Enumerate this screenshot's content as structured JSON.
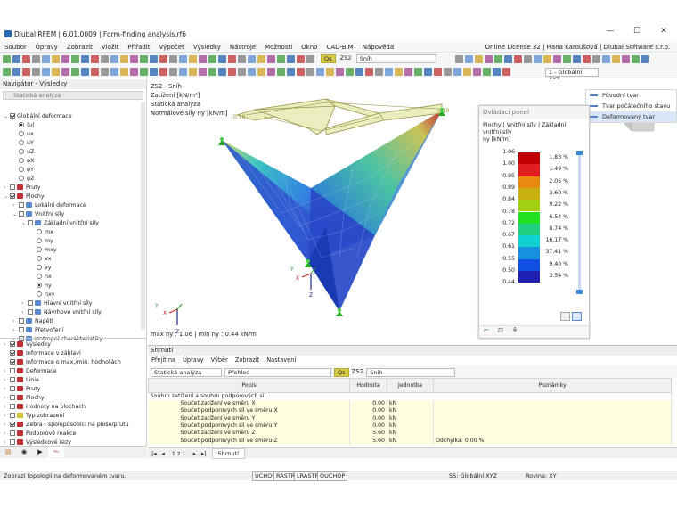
{
  "app": {
    "title": "Dlubal RFEM | 6.01.0009 | Form-finding analysis.rf6",
    "license": "Online License 32 | Hana Karoušová | Dlubal Software s.r.o.",
    "window_controls": [
      "—",
      "☐",
      "✕"
    ]
  },
  "menu": [
    "Soubor",
    "Úpravy",
    "Zobrazit",
    "Vložit",
    "Přiřadit",
    "Výpočet",
    "Výsledky",
    "Nástroje",
    "Možnosti",
    "Okno",
    "CAD-BIM",
    "Nápověda"
  ],
  "toolbar": {
    "lc_badge": "Qs",
    "lc_id": "ZS2",
    "lc_name": "Sníh",
    "coord_system": "1 - Globální XYZ"
  },
  "navigator": {
    "title": "Navigátor - Výsledky",
    "combo": "Statická analýza",
    "tree": [
      {
        "label": "Globální deformace",
        "depth": 0,
        "exp": "⌄",
        "control": "cb-chk"
      },
      {
        "label": "|u|",
        "depth": 1,
        "control": "rb-sel"
      },
      {
        "label": "ux",
        "depth": 1,
        "control": "rb"
      },
      {
        "label": "uY",
        "depth": 1,
        "control": "rb"
      },
      {
        "label": "uZ",
        "depth": 1,
        "control": "rb"
      },
      {
        "label": "φX",
        "depth": 1,
        "control": "rb"
      },
      {
        "label": "φY",
        "depth": 1,
        "control": "rb"
      },
      {
        "label": "φZ",
        "depth": 1,
        "control": "rb"
      },
      {
        "label": "Pruty",
        "depth": 0,
        "exp": "›",
        "control": "cb",
        "icon": "#c03030"
      },
      {
        "label": "Plochy",
        "depth": 0,
        "exp": "⌄",
        "control": "cb-chk",
        "icon": "#c03030"
      },
      {
        "label": "Lokální deformace",
        "depth": 1,
        "exp": "›",
        "control": "cb",
        "icon": "#5a8bd0"
      },
      {
        "label": "Vnitřní síly",
        "depth": 1,
        "exp": "⌄",
        "control": "cb",
        "icon": "#5a8bd0"
      },
      {
        "label": "Základní vnitřní síly",
        "depth": 2,
        "exp": "⌄",
        "control": "cb",
        "icon": "#5a8bd0"
      },
      {
        "label": "mx",
        "depth": 3,
        "control": "rb"
      },
      {
        "label": "my",
        "depth": 3,
        "control": "rb"
      },
      {
        "label": "mxy",
        "depth": 3,
        "control": "rb"
      },
      {
        "label": "vx",
        "depth": 3,
        "control": "rb"
      },
      {
        "label": "vy",
        "depth": 3,
        "control": "rb"
      },
      {
        "label": "nx",
        "depth": 3,
        "control": "rb"
      },
      {
        "label": "ny",
        "depth": 3,
        "control": "rb-sel"
      },
      {
        "label": "nxy",
        "depth": 3,
        "control": "rb"
      },
      {
        "label": "Hlavní vnitřní síly",
        "depth": 2,
        "exp": "›",
        "control": "cb",
        "icon": "#5a8bd0"
      },
      {
        "label": "Návrhové vnitřní síly",
        "depth": 2,
        "exp": "›",
        "control": "cb",
        "icon": "#5a8bd0"
      },
      {
        "label": "Napětí",
        "depth": 1,
        "exp": "›",
        "control": "cb",
        "icon": "#5a8bd0"
      },
      {
        "label": "Přetvoření",
        "depth": 1,
        "exp": "›",
        "control": "cb",
        "icon": "#5a8bd0"
      },
      {
        "label": "Izotropní charakteristiky",
        "depth": 1,
        "exp": "›",
        "control": "cb",
        "icon": "#5a8bd0"
      }
    ],
    "tree2": [
      {
        "label": "Výsledky",
        "exp": "›",
        "control": "cb-chk",
        "icon": "#c03030"
      },
      {
        "label": "Informace v záhlaví",
        "exp": "",
        "control": "cb-chk",
        "icon": "#c03030"
      },
      {
        "label": "Informace o max./min. hodnotách",
        "exp": "",
        "control": "cb-chk",
        "icon": "#c03030"
      },
      {
        "label": "Deformace",
        "exp": "›",
        "control": "cb",
        "icon": "#c03030"
      },
      {
        "label": "Linie",
        "exp": "›",
        "control": "cb",
        "icon": "#c03030"
      },
      {
        "label": "Pruty",
        "exp": "›",
        "control": "cb",
        "icon": "#c03030"
      },
      {
        "label": "Plochy",
        "exp": "›",
        "control": "cb",
        "icon": "#c03030"
      },
      {
        "label": "Hodnoty na plochách",
        "exp": "›",
        "control": "cb",
        "icon": "#c03030"
      },
      {
        "label": "Typ zobrazení",
        "exp": "›",
        "control": "cb",
        "icon": "#d0c030"
      },
      {
        "label": "Zebra - spolupůsobící na ploše/prutu",
        "exp": "›",
        "control": "cb-chk",
        "icon": "#c03030"
      },
      {
        "label": "Podporové reakce",
        "exp": "›",
        "control": "cb",
        "icon": "#c03030"
      },
      {
        "label": "Výsledkové řezy",
        "exp": "›",
        "control": "cb",
        "icon": "#c03030"
      }
    ]
  },
  "viewport": {
    "info": [
      "ZS2 - Sníh",
      "Zatížení [kN/m²]",
      "Statická analýza",
      "Normálové síly ny [kN/m]"
    ],
    "load_value_left": "0.10",
    "load_value_right": "0.10",
    "maxmin": "max ny : 1.06 | min ny : 0.44 kN/m"
  },
  "control_panel": {
    "title": "Ovládací panel",
    "subtitle": "Plochy | Vnitřní síly | Základní vnitřní síly",
    "unit": "ny [kN/m]",
    "levels": [
      "1.06",
      "1.00",
      "0.95",
      "0.89",
      "0.84",
      "0.78",
      "0.72",
      "0.67",
      "0.61",
      "0.55",
      "0.50",
      "0.44"
    ],
    "bands": [
      {
        "color": "#c00000",
        "pct": "1.83 %"
      },
      {
        "color": "#e02020",
        "pct": "1.49 %"
      },
      {
        "color": "#e88a10",
        "pct": "2.05 %"
      },
      {
        "color": "#c8b010",
        "pct": "3.60 %"
      },
      {
        "color": "#a0d010",
        "pct": "9.22 %"
      },
      {
        "color": "#20e020",
        "pct": "6.54 %"
      },
      {
        "color": "#20d080",
        "pct": "8.74 %"
      },
      {
        "color": "#10d0d0",
        "pct": "16.17 %"
      },
      {
        "color": "#1890e0",
        "pct": "37.41 %"
      },
      {
        "color": "#1050e0",
        "pct": "9.40 %"
      },
      {
        "color": "#2020b0",
        "pct": "3.54 %"
      }
    ]
  },
  "shape_menu": [
    "Původní tvar",
    "Tvar počátečního stavu",
    "Deformovaný tvar"
  ],
  "summary": {
    "title": "Shrnutí",
    "menu": [
      "Přejít na",
      "Úpravy",
      "Výběr",
      "Zobrazit",
      "Nastavení"
    ],
    "combo1": "Statická analýza",
    "combo2": "Přehled",
    "lc_badge": "Qs",
    "lc_id": "ZS2",
    "lc_name": "Sníh",
    "headers": [
      "Popis",
      "Hodnota",
      "Jednotka",
      "Poznámky"
    ],
    "group": "Souhrn zatížení a souhrn podporových sil",
    "rows": [
      [
        "Součet zatížení ve směru X",
        "0.00",
        "kN",
        ""
      ],
      [
        "Součet podporových sil ve směru X",
        "0.00",
        "kN",
        ""
      ],
      [
        "Součet zatížení ve směru Y",
        "0.00",
        "kN",
        ""
      ],
      [
        "Součet podporových sil ve směru Y",
        "0.00",
        "kN",
        ""
      ],
      [
        "Součet zatížení ve směru Z",
        "5.60",
        "kN",
        ""
      ],
      [
        "Součet podporových sil ve směru Z",
        "5.60",
        "kN",
        "Odchylka: 0.00 %"
      ]
    ],
    "pager": "1 z 1",
    "tab": "Shrnutí"
  },
  "status": {
    "message": "Zobrazí topologii na deformovaném tvaru.",
    "buttons": [
      "ÚCHOP",
      "RASTR",
      "LRASTR",
      "OUCHOP"
    ],
    "cs": "SS: Globální XYZ",
    "plane": "Rovina: XY"
  }
}
